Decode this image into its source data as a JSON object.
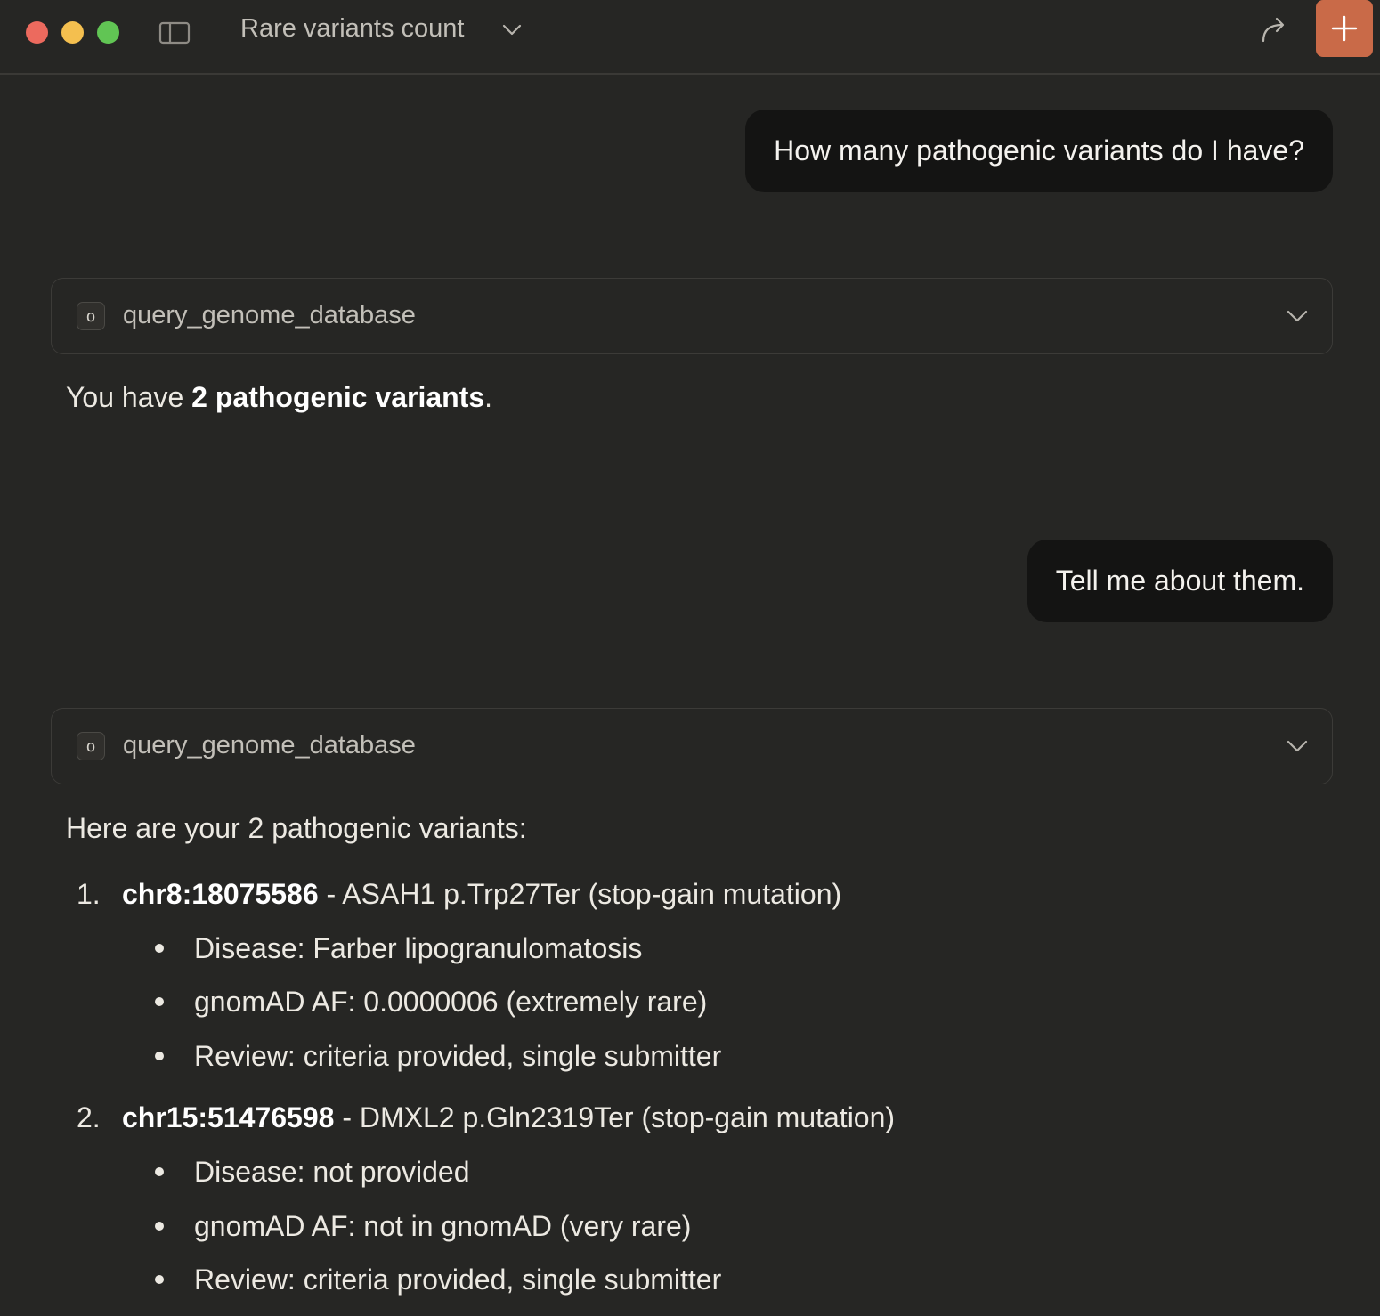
{
  "window": {
    "title": "Rare variants count",
    "controls": [
      "close",
      "minimize",
      "zoom"
    ],
    "icons": {
      "sidebar": "sidebar-toggle-icon",
      "title_menu": "chevron-down-icon",
      "share": "share-icon",
      "new_chat": "plus-icon"
    },
    "colors": {
      "background": "#262624",
      "new_chat_button": "#c96a48",
      "user_bubble": "#141413"
    }
  },
  "conversation": {
    "messages": [
      {
        "role": "user",
        "text": "How many pathogenic variants do I have?"
      },
      {
        "role": "assistant",
        "tool_call": {
          "icon_glyph": "o",
          "name": "query_genome_database"
        },
        "text_prefix": "You have ",
        "text_bold": "2 pathogenic variants",
        "text_suffix": "."
      },
      {
        "role": "user",
        "text": "Tell me about them."
      },
      {
        "role": "assistant",
        "tool_call": {
          "icon_glyph": "o",
          "name": "query_genome_database"
        },
        "intro": "Here are your 2 pathogenic variants:",
        "variants": [
          {
            "number": "1.",
            "location": "chr8:18075586",
            "description": " - ASAH1 p.Trp27Ter (stop-gain mutation)",
            "details": [
              "Disease: Farber lipogranulomatosis",
              "gnomAD AF: 0.0000006 (extremely rare)",
              "Review: criteria provided, single submitter"
            ]
          },
          {
            "number": "2.",
            "location": "chr15:51476598",
            "description": " - DMXL2 p.Gln2319Ter (stop-gain mutation)",
            "details": [
              "Disease: not provided",
              "gnomAD AF: not in gnomAD (very rare)",
              "Review: criteria provided, single submitter"
            ]
          }
        ]
      }
    ]
  }
}
